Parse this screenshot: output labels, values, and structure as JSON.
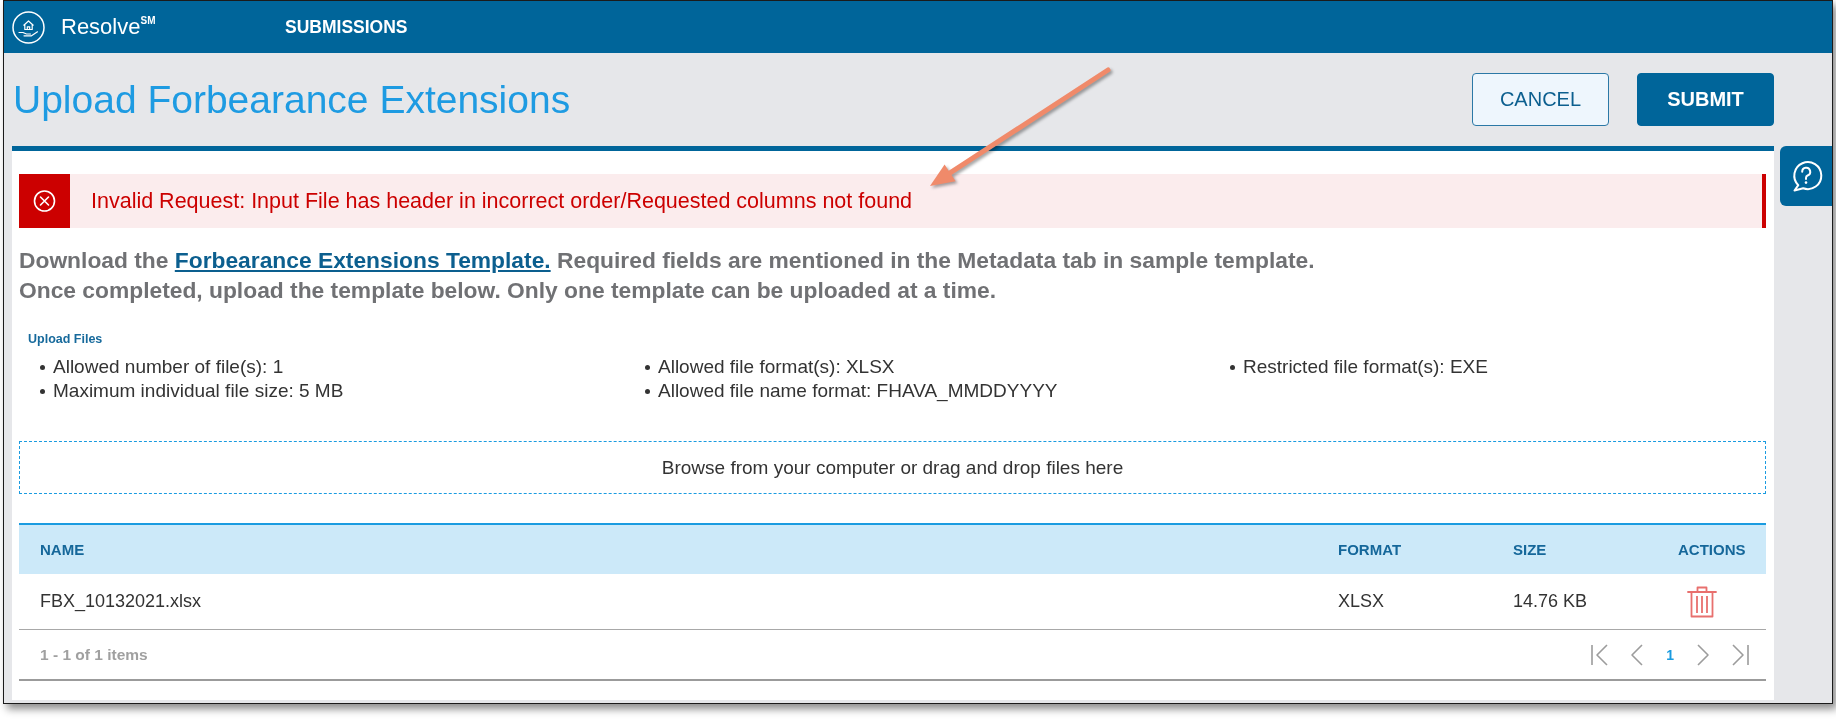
{
  "header": {
    "brand": "Resolve$^{SM}$",
    "nav": [
      {
        "label": "SUBMISSIONS"
      }
    ]
  },
  "page": {
    "title": "Upload Forbearance Extensions",
    "actions": [
      {
        "label": "CANCEL",
        "kind": "secondary"
      },
      {
        "label": "SUBMIT",
        "kind": "primary"
      }
    ]
  },
  "alert": {
    "kind": "error",
    "message": "Invalid Request: Input File has header in incorrect order/Requested columns not found"
  },
  "instructions": {
    "lines": [
      {
        "text": "Download the",
        "link": "Forbearance Extensions Template.",
        "after": "Required fields are mentioned in the Metadata tab in sample template."
      },
      {
        "text": "Once completed, upload the template below. Only one template can be uploaded at a time."
      }
    ]
  },
  "upload_files": {
    "label": "Upload Files",
    "rule_columns": [
      [
        "Allowed number of file(s): 1",
        "Maximum individual file size: 5 MB"
      ],
      [
        "Allowed file format(s): XLSX",
        "Allowed file name format: FHAVA_MMDDYYYY"
      ],
      [
        "Restricted file format(s): EXE"
      ]
    ],
    "dropzone": "Browse from your computer or drag and drop files here"
  },
  "table": {
    "columns": [
      "NAME",
      "FORMAT",
      "SIZE",
      "ACTIONS"
    ],
    "rows": [
      {
        "cells": [
          "FBX_10132021.xlsx",
          "XLSX",
          "14.76 KB"
        ],
        "actions": [
          {
            "kind": "delete"
          }
        ]
      }
    ],
    "summary": "1 - 1 of 1 items",
    "pages": [
      {
        "label": "1",
        "selected": true
      }
    ]
  }
}
